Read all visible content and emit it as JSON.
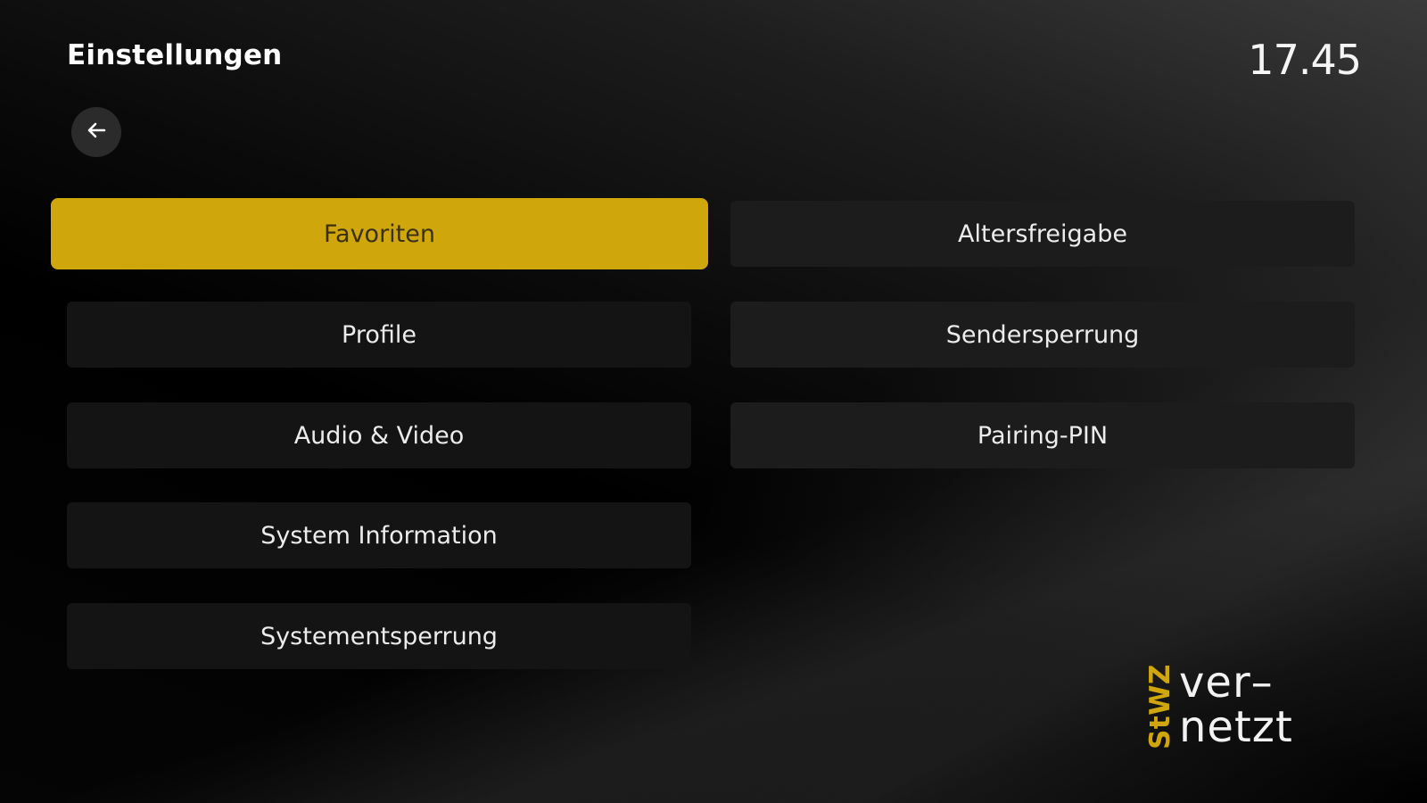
{
  "header": {
    "title": "Einstellungen",
    "clock": "17.45",
    "back_icon": "arrow-left-icon"
  },
  "menu": {
    "left": [
      {
        "label": "Favoriten",
        "focused": true
      },
      {
        "label": "Profile"
      },
      {
        "label": "Audio & Video"
      },
      {
        "label": "System Information"
      },
      {
        "label": "Systementsperrung"
      }
    ],
    "right": [
      {
        "label": "Altersfreigabe"
      },
      {
        "label": "Sendersperrung"
      },
      {
        "label": "Pairing-PIN"
      }
    ]
  },
  "logo": {
    "mark": "StWZ",
    "line1": "ver–",
    "line2": "netzt"
  },
  "colors": {
    "accent": "#cfa60c",
    "button_bg": "#141414",
    "back_button_bg": "#2b2b2b",
    "background": "#000000"
  }
}
